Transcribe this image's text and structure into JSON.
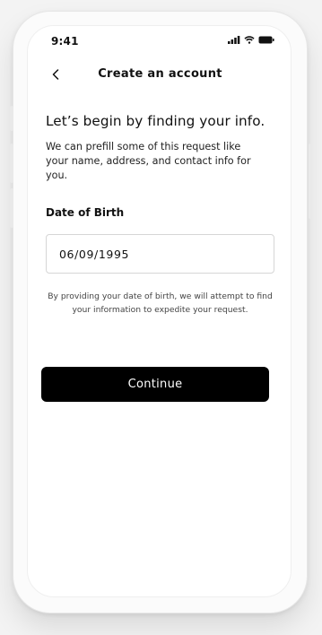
{
  "status_bar": {
    "time": "9:41"
  },
  "nav": {
    "title": "Create an account"
  },
  "heading": "Let’s begin by finding your info.",
  "intro": "We can prefill some of this request like your name, address, and contact info for you.",
  "dob": {
    "label": "Date of Birth",
    "value": "06/09/1995"
  },
  "note": "By providing your date of birth, we will attempt to find your information to expedite your request.",
  "button": {
    "label": "Continue"
  },
  "icons": {
    "back": "chevron-left-icon",
    "signal": "signal-icon",
    "wifi": "wifi-icon",
    "battery": "battery-icon"
  },
  "colors": {
    "primary_button": "#000000",
    "button_text": "#ffffff"
  }
}
